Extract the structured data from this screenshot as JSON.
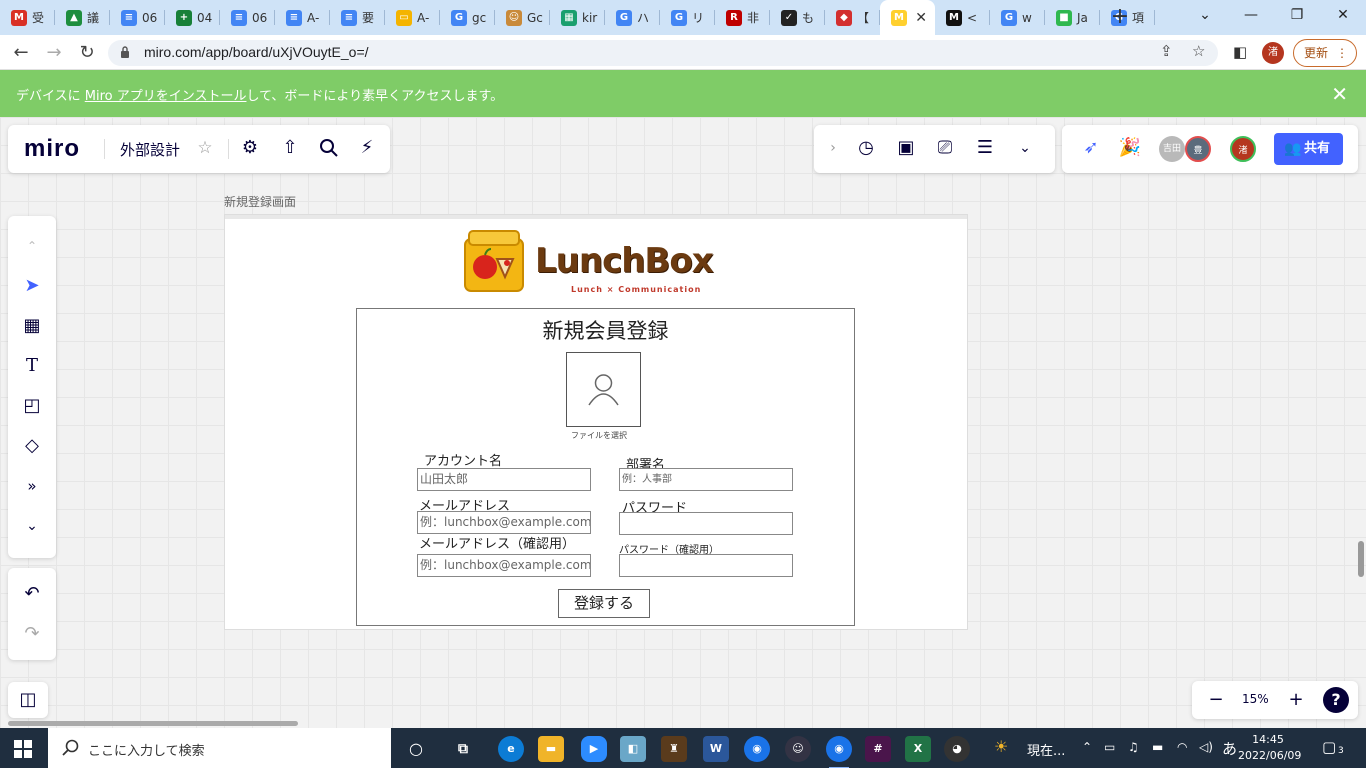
{
  "browser": {
    "tabs": [
      {
        "label": "受",
        "favicon_letter": "M",
        "color": "#d93025"
      },
      {
        "label": "議",
        "favicon_letter": "▲",
        "color": "#1e8e3e"
      },
      {
        "label": "06",
        "favicon_letter": "≡",
        "color": "#4285f4"
      },
      {
        "label": "04",
        "favicon_letter": "+",
        "color": "#188038"
      },
      {
        "label": "06",
        "favicon_letter": "≡",
        "color": "#4285f4"
      },
      {
        "label": "A-",
        "favicon_letter": "≡",
        "color": "#4285f4"
      },
      {
        "label": "要",
        "favicon_letter": "≡",
        "color": "#4285f4"
      },
      {
        "label": "A-",
        "favicon_letter": "▭",
        "color": "#f4b400"
      },
      {
        "label": "gc",
        "favicon_letter": "G",
        "color": "#4285f4"
      },
      {
        "label": "Gc",
        "favicon_letter": "☺",
        "color": "#c98a3a"
      },
      {
        "label": "kir",
        "favicon_letter": "▦",
        "color": "#1a9f6e"
      },
      {
        "label": "ハ",
        "favicon_letter": "G",
        "color": "#4285f4"
      },
      {
        "label": "リ",
        "favicon_letter": "G",
        "color": "#4285f4"
      },
      {
        "label": "非",
        "favicon_letter": "R",
        "color": "#bf0000"
      },
      {
        "label": "も",
        "favicon_letter": "✓",
        "color": "#222"
      },
      {
        "label": "【",
        "favicon_letter": "◆",
        "color": "#d32f2f"
      },
      {
        "label": "",
        "favicon_letter": "M",
        "color": "#ffd02f",
        "active": true
      },
      {
        "label": "<",
        "favicon_letter": "M",
        "color": "#111"
      },
      {
        "label": "w",
        "favicon_letter": "G",
        "color": "#4285f4"
      },
      {
        "label": "Ja",
        "favicon_letter": "■",
        "color": "#2fb84f"
      },
      {
        "label": "項",
        "favicon_letter": "G",
        "color": "#4285f4"
      }
    ],
    "url": "miro.com/app/board/uXjVOuytE_o=/",
    "profile_initial": "渚",
    "update_label": "更新"
  },
  "banner": {
    "text_before": "デバイスに ",
    "link_text": "Miro アプリをインストール",
    "text_after": "して、ボードにより素早くアクセスします。"
  },
  "miro": {
    "logo": "miro",
    "board_name": "外部設計",
    "share_label": "共有",
    "avatars": [
      {
        "initial": "吉田",
        "color": "#b9b9b9"
      },
      {
        "initial": "豊",
        "color": "#5b6b7c"
      },
      {
        "initial": "渚",
        "color": "#b5361f"
      }
    ],
    "zoom": "15%"
  },
  "frame": {
    "label": "新規登録画面",
    "logo_text": "LunchBox",
    "logo_sub": "Lunch × Communication",
    "form": {
      "title": "新規会員登録",
      "file_label": "ファイルを選択",
      "account_label": "アカウント名",
      "account_value": "山田太郎",
      "dept_label": "部署名",
      "dept_placeholder": "例：人事部",
      "email_label": "メールアドレス",
      "email_placeholder": "例：lunchbox@example.com",
      "password_label": "パスワード",
      "email_confirm_label": "メールアドレス（確認用）",
      "email_confirm_placeholder": "例：lunchbox@example.com",
      "password_confirm_label": "パスワード（確認用）",
      "submit_label": "登録する"
    }
  },
  "taskbar": {
    "search_placeholder": "ここに入力して検索",
    "weather_text": "現在...",
    "ime": "あ",
    "time": "14:45",
    "date": "2022/06/09",
    "notification_count": "3"
  }
}
